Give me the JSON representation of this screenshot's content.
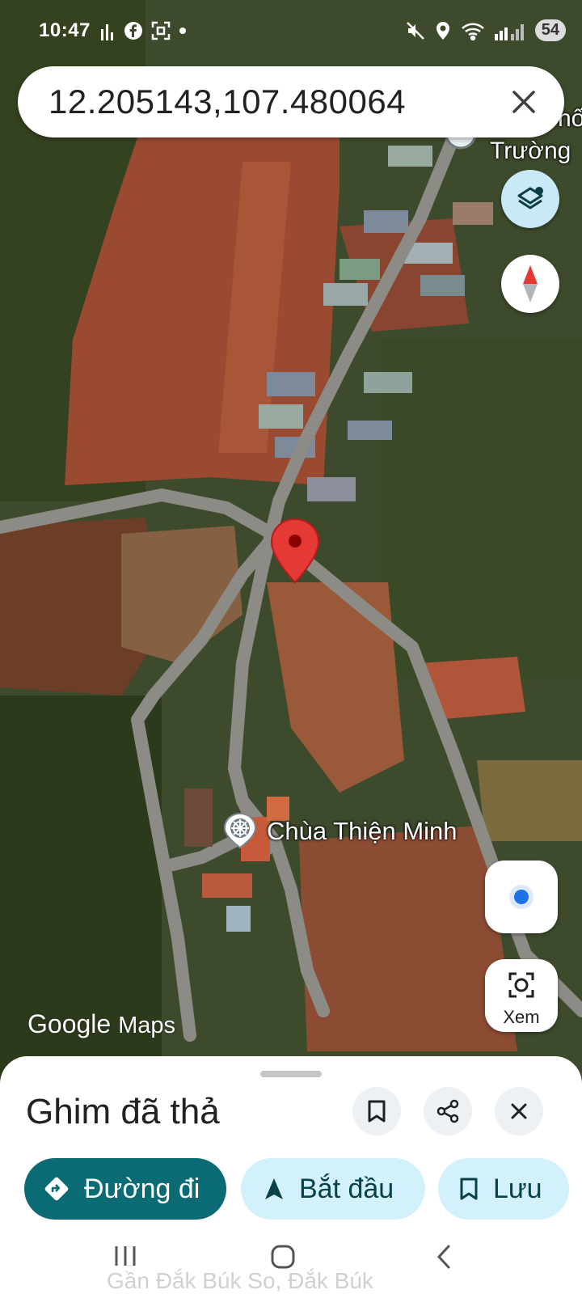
{
  "status_bar": {
    "time": "10:47",
    "battery": "54",
    "icons": [
      "signal-bars-icon",
      "facebook-icon",
      "screenshot-icon",
      "dot-icon",
      "mute-icon",
      "location-icon",
      "wifi-icon",
      "cell-signal-icon"
    ]
  },
  "search": {
    "query": "12.205143,107.480064",
    "clear_icon": "close-icon"
  },
  "map": {
    "pin_color": "#e53935",
    "poi_label": "Chùa Thiện Minh",
    "poi_icon": "dharma-wheel-icon",
    "place_label_top": "Trường",
    "place_label_top_partial": "hố",
    "layers_icon": "layers-icon",
    "compass_icon": "compass-icon",
    "location_icon": "my-location-icon",
    "view_button_label": "Xem",
    "view_icon": "camera-lens-icon",
    "logo_google": "Google",
    "logo_maps": "Maps"
  },
  "sheet": {
    "title": "Ghim đã thả",
    "bookmark_icon": "bookmark-icon",
    "share_icon": "share-icon",
    "close_icon": "close-icon",
    "chips": {
      "directions": "Đường đi",
      "start": "Bắt đầu",
      "save": "Lưu"
    },
    "partial_text": "Gần Đắk Búk So, Đắk Búk"
  },
  "colors": {
    "accent": "#0b6b74",
    "chip_light": "#d3f1fb",
    "location_blue": "#1a73e8"
  }
}
